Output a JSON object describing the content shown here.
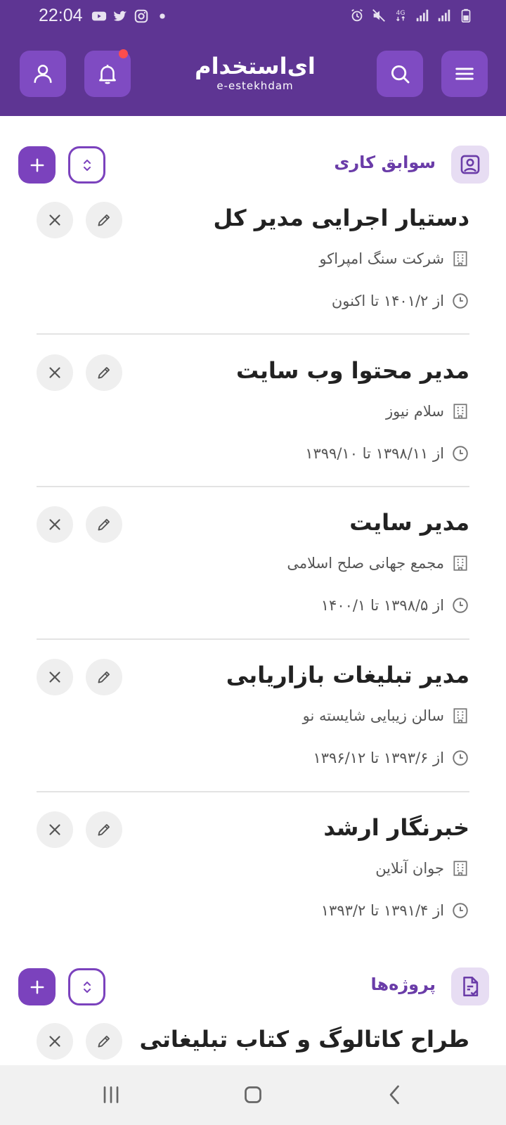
{
  "status_bar": {
    "time": "22:04",
    "left_icons": [
      "youtube-icon",
      "twitter-icon",
      "instagram-icon",
      "dot-icon"
    ],
    "right_icons": [
      "alarm-icon",
      "mute-icon",
      "4g-icon",
      "signal-icon",
      "signal-icon",
      "battery-icon"
    ],
    "network_label": "4G"
  },
  "header": {
    "logo_text": "ای‌استخدام",
    "logo_subtext": "e-estekhdam",
    "has_notification": true,
    "colors": {
      "bar": "#5e3593",
      "button": "#7f4bc2",
      "notification": "#ff4d4d"
    }
  },
  "sections": {
    "work": {
      "title": "سوابق کاری",
      "icon": "person-card-icon",
      "items": [
        {
          "title": "دستیار اجرایی مدیر کل",
          "company": "شرکت سنگ امپراکو",
          "date": "از ۱۴۰۱/۲ تا اکنون"
        },
        {
          "title": "مدیر محتوا وب سایت",
          "company": "سلام نیوز",
          "date": "از ۱۳۹۸/۱۱ تا ۱۳۹۹/۱۰"
        },
        {
          "title": "مدیر سایت",
          "company": "مجمع جهانی صلح اسلامی",
          "date": "از ۱۳۹۸/۵ تا ۱۴۰۰/۱"
        },
        {
          "title": "مدیر تبلیغات بازاریابی",
          "company": "سالن زیبایی شایسته نو",
          "date": "از ۱۳۹۳/۶ تا ۱۳۹۶/۱۲"
        },
        {
          "title": "خبرنگار ارشد",
          "company": "جوان آنلاین",
          "date": "از ۱۳۹۱/۴ تا ۱۳۹۳/۲"
        }
      ]
    },
    "projects": {
      "title": "پروژه‌ها",
      "icon": "document-check-icon",
      "items": [
        {
          "title": "طراح کاتالوگ و کتاب تبلیغاتی"
        }
      ]
    }
  },
  "navbar": {
    "buttons": [
      "recent-apps-icon",
      "home-icon",
      "back-icon"
    ]
  },
  "accent_color": "#7b42bd"
}
